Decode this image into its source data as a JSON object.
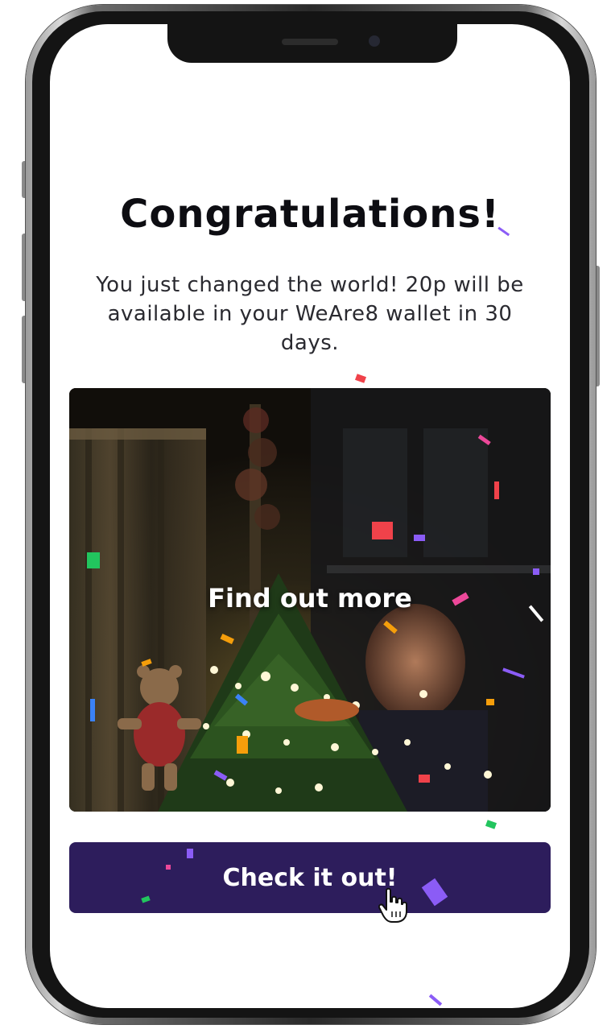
{
  "screen": {
    "title": "Congratulations!",
    "message": "You just changed the world! 20p will be available in your WeAre8 wallet in 30 days."
  },
  "media": {
    "overlay_label": "Find out more",
    "scene": "christmas-tree-video-still"
  },
  "cta": {
    "label": "Check it out!"
  },
  "colors": {
    "cta_background": "#2d1d5c",
    "title_text": "#0d0d12",
    "confetti": [
      "#f0424a",
      "#8b5cf6",
      "#f59e0b",
      "#22c55e",
      "#3b82f6",
      "#ec4899"
    ]
  },
  "icons": {
    "cursor": "hand-pointer-icon"
  }
}
